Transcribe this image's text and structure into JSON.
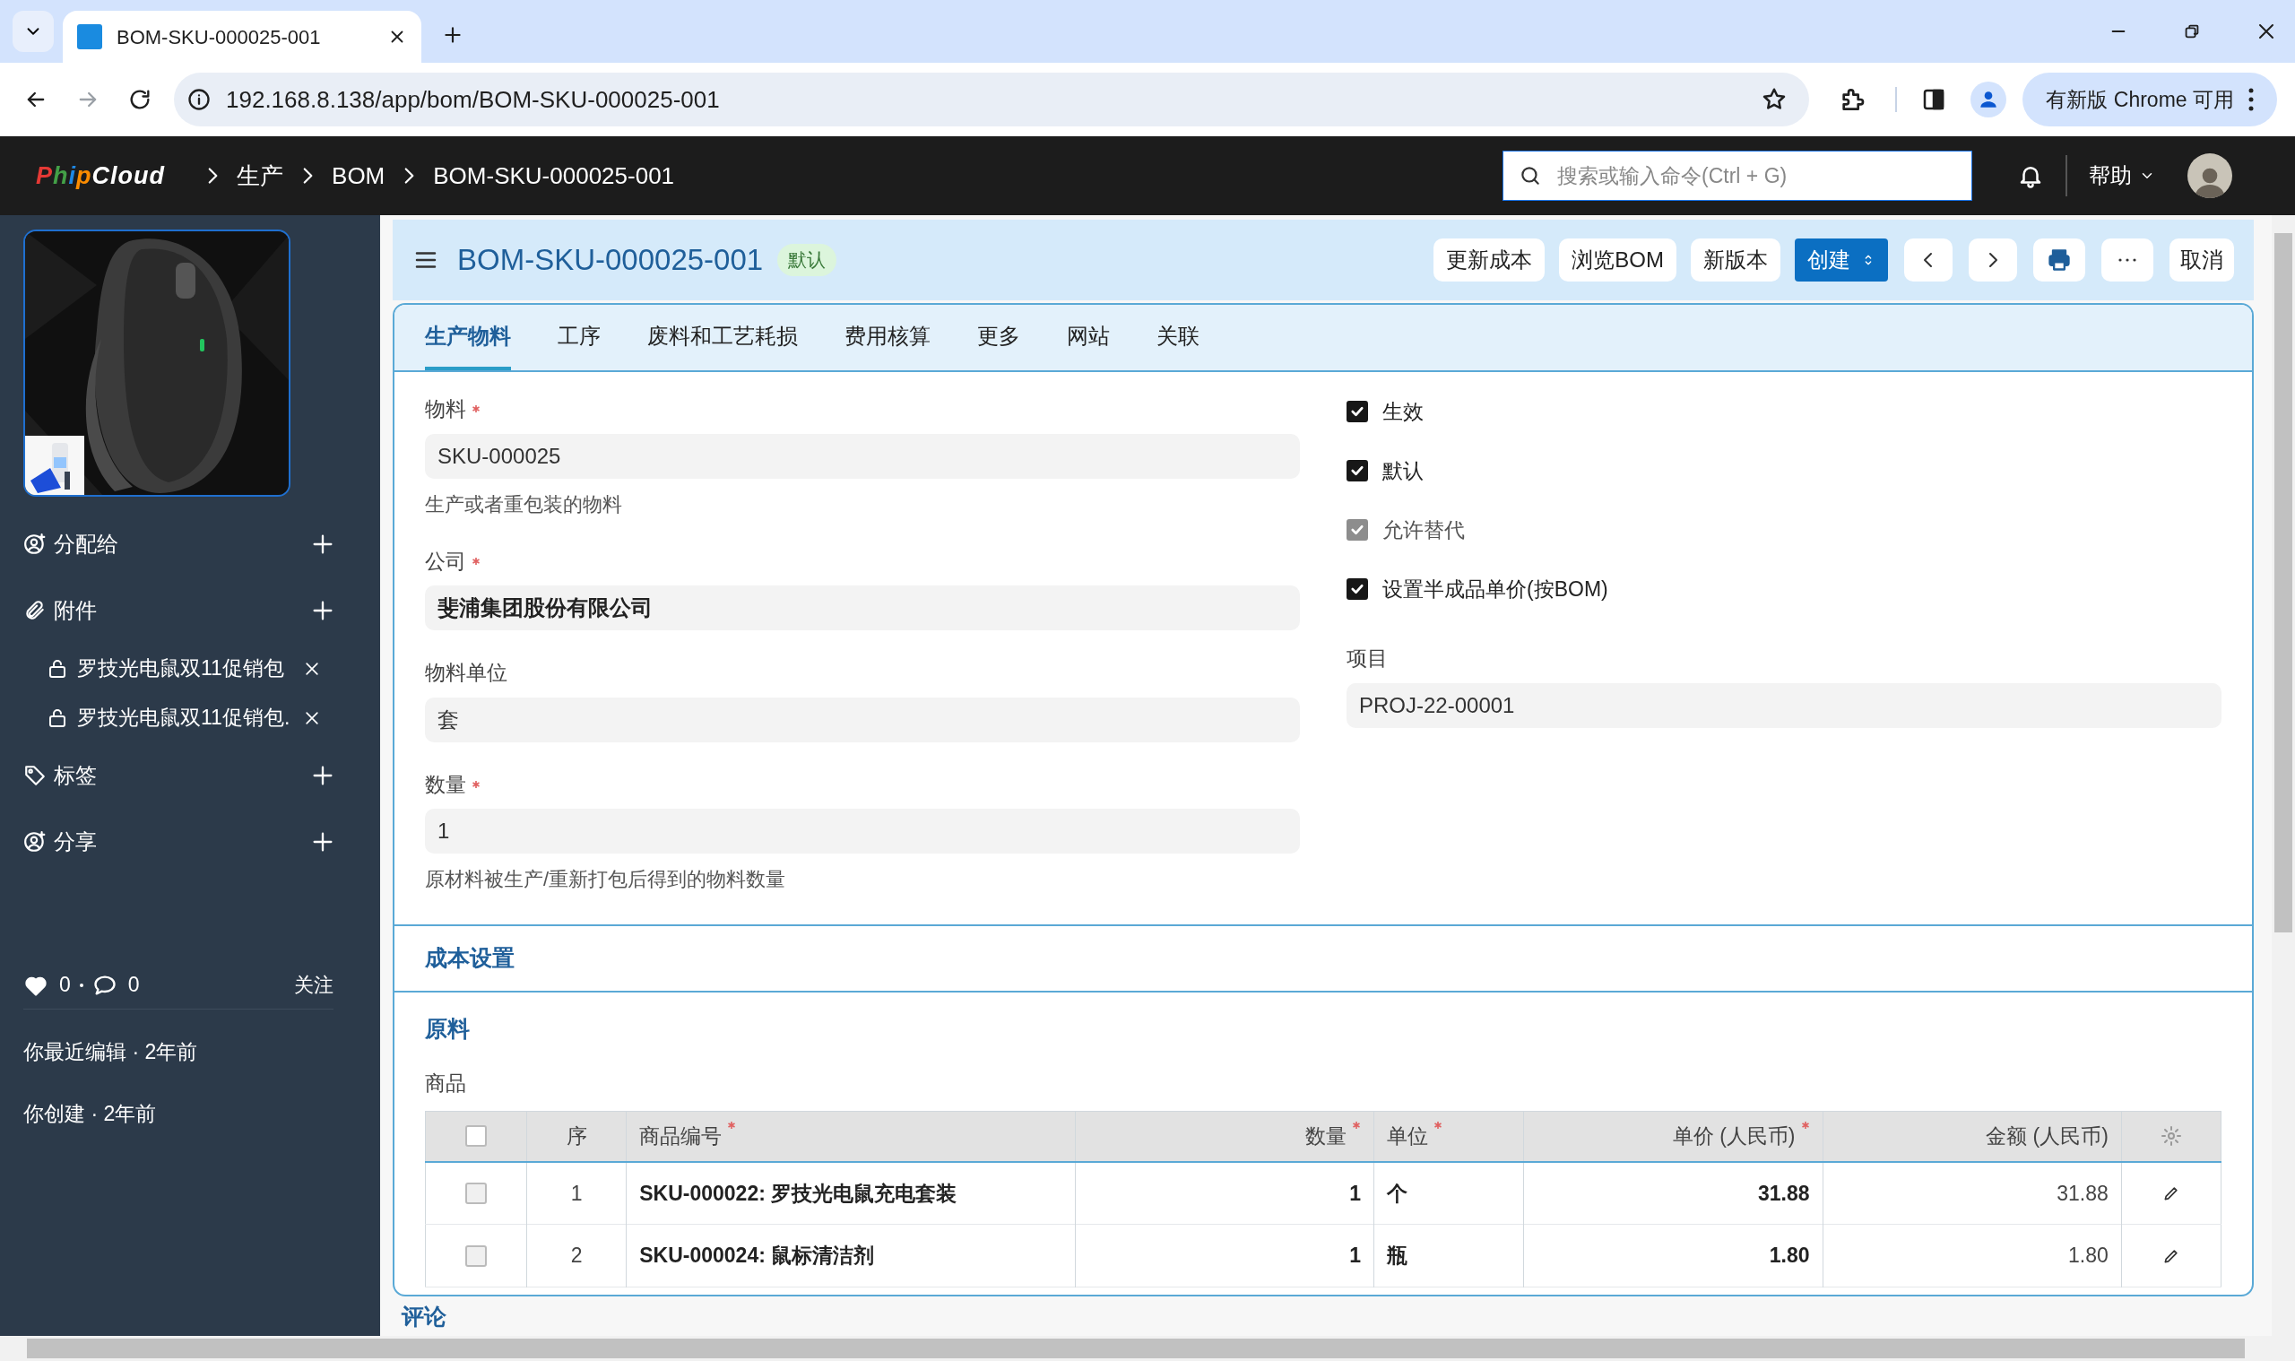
{
  "browser": {
    "tab_title": "BOM-SKU-000025-001",
    "url": "192.168.8.138/app/bom/BOM-SKU-000025-001",
    "update_button": "有新版 Chrome 可用"
  },
  "navbar": {
    "logo": "PhipCloud",
    "breadcrumbs": [
      "生产",
      "BOM",
      "BOM-SKU-000025-001"
    ],
    "search": {
      "placeholder": "搜索或输入命令(Ctrl + G)"
    },
    "help": "帮助"
  },
  "sidebar": {
    "sections": [
      {
        "kind": "assign",
        "label": "分配给"
      },
      {
        "kind": "attach",
        "label": "附件",
        "items": [
          "罗技光电鼠双11促销包",
          "罗技光电鼠双11促销包."
        ]
      },
      {
        "kind": "tag",
        "label": "标签"
      },
      {
        "kind": "assign",
        "label": "分享"
      }
    ],
    "likes": "0",
    "comments": "0",
    "follow": "关注",
    "activity": [
      "你最近编辑 · 2年前",
      "你创建 · 2年前"
    ]
  },
  "page": {
    "title": "BOM-SKU-000025-001",
    "status": "默认",
    "actions": [
      "更新成本",
      "浏览BOM",
      "新版本"
    ],
    "primary": "创建",
    "cancel": "取消"
  },
  "tabs": [
    {
      "label": "生产物料",
      "selected": true
    },
    {
      "label": "工序",
      "selected": false
    },
    {
      "label": "废料和工艺耗损",
      "selected": false
    },
    {
      "label": "费用核算",
      "selected": false
    },
    {
      "label": "更多",
      "selected": false
    },
    {
      "label": "网站",
      "selected": false
    },
    {
      "label": "关联",
      "selected": false
    }
  ],
  "fields": [
    {
      "label": "物料",
      "required": true,
      "value": "SKU-000025",
      "bold": false,
      "description": "生产或者重包装的物料"
    },
    {
      "label": "公司",
      "required": true,
      "value": "斐浦集团股份有限公司",
      "bold": true
    },
    {
      "label": "物料单位",
      "required": false,
      "value": "套",
      "bold": false
    },
    {
      "label": "数量",
      "required": true,
      "value": "1",
      "bold": false,
      "description": "原材料被生产/重新打包后得到的物料数量"
    }
  ],
  "checks": [
    {
      "label": "生效",
      "checked": true,
      "disabled": false
    },
    {
      "label": "默认",
      "checked": true,
      "disabled": false
    },
    {
      "label": "允许替代",
      "checked": true,
      "disabled": true
    },
    {
      "label": "设置半成品单价(按BOM)",
      "checked": true,
      "disabled": false
    }
  ],
  "project": {
    "label": "项目",
    "value": "PROJ-22-00001"
  },
  "sections": [
    "成本设置",
    "原料"
  ],
  "table": {
    "label": "商品",
    "select_all": false,
    "columns": [
      {
        "label": "序",
        "required": false
      },
      {
        "label": "商品编号",
        "required": true
      },
      {
        "label": "数量",
        "required": true
      },
      {
        "label": "单位",
        "required": true
      },
      {
        "label": "单价 (人民币)",
        "required": true
      },
      {
        "label": "金额 (人民币)",
        "required": false
      }
    ],
    "rows": [
      {
        "selected": false,
        "cells": [
          "1",
          "SKU-000022: 罗技光电鼠充电套装",
          "1",
          "个",
          "31.88",
          "31.88"
        ]
      },
      {
        "selected": false,
        "cells": [
          "2",
          "SKU-000024: 鼠标清洁剂",
          "1",
          "瓶",
          "1.80",
          "1.80"
        ]
      }
    ]
  },
  "comments_heading": "评论"
}
